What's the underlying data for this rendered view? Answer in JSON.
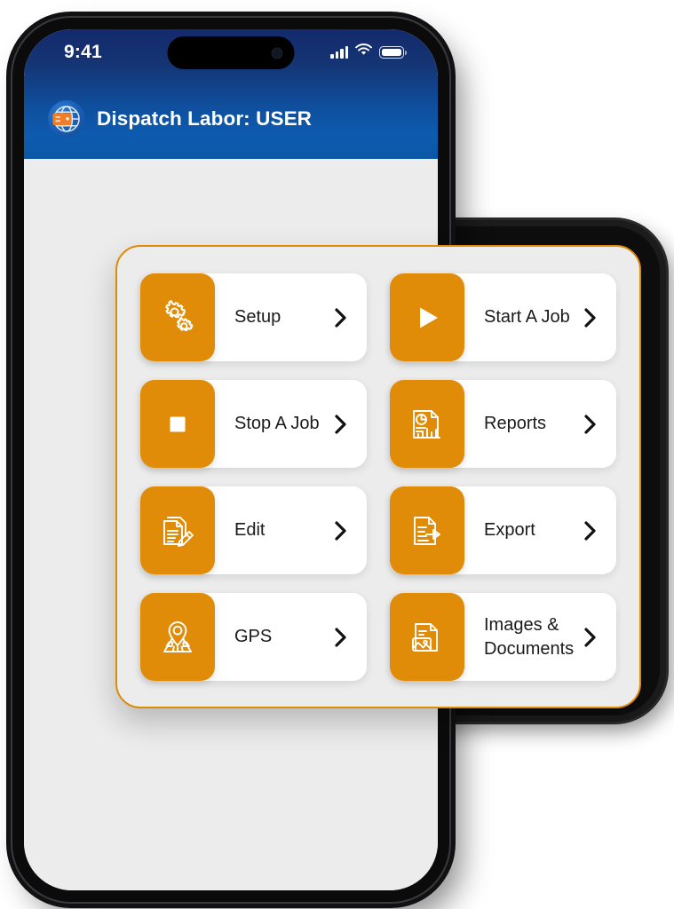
{
  "device": {
    "status_bar": {
      "time": "9:41",
      "icons": [
        "cellular-signal-icon",
        "wifi-icon",
        "battery-icon"
      ]
    },
    "app_bar": {
      "logo_icon": "globe-card-logo-icon",
      "title": "Dispatch Labor: USER"
    }
  },
  "theme": {
    "accent": "#e08c09",
    "accent_border": "#dd8b07",
    "header_blue_top": "#132a6d",
    "header_blue_bottom": "#0c57a6",
    "screen_bg": "#ececec",
    "card_bg": "#ffffff",
    "text": "#1a1a1a"
  },
  "menu": {
    "items": [
      {
        "label": "Setup",
        "icon": "gears-icon"
      },
      {
        "label": "Start A Job",
        "icon": "play-icon"
      },
      {
        "label": "Stop A Job",
        "icon": "stop-square-icon"
      },
      {
        "label": "Reports",
        "icon": "report-chart-icon"
      },
      {
        "label": "Edit",
        "icon": "document-pencil-icon"
      },
      {
        "label": "Export",
        "icon": "document-export-icon"
      },
      {
        "label": "GPS",
        "icon": "map-pin-icon"
      },
      {
        "label": "Images &\nDocuments",
        "icon": "image-document-icon"
      }
    ],
    "chevron_icon": "chevron-right-icon"
  },
  "callout": {
    "dot_icon": "callout-dot-icon",
    "line_icon": "callout-line-icon"
  }
}
